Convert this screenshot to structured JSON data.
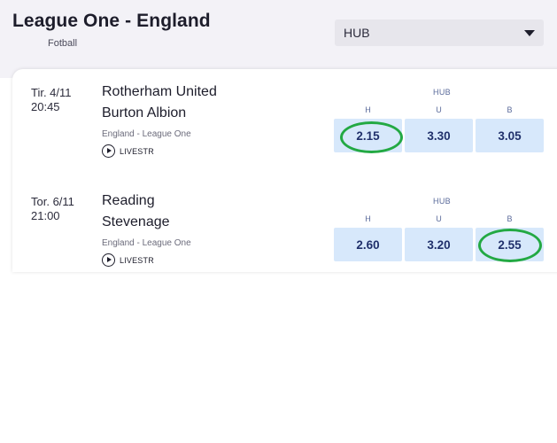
{
  "header": {
    "title": "League One - England",
    "sport": "Fotball",
    "market_select": {
      "value": "HUB"
    }
  },
  "matches": [
    {
      "date": "Tir. 4/11",
      "time": "20:45",
      "home": "Rotherham United",
      "away": "Burton Albion",
      "competition": "England - League One",
      "live_label": "LIVESTR",
      "market": "HUB",
      "outcomes": [
        {
          "label": "H",
          "odds": "2.15",
          "highlighted": true
        },
        {
          "label": "U",
          "odds": "3.30",
          "highlighted": false
        },
        {
          "label": "B",
          "odds": "3.05",
          "highlighted": false
        }
      ]
    },
    {
      "date": "Tor. 6/11",
      "time": "21:00",
      "home": "Reading",
      "away": "Stevenage",
      "competition": "England - League One",
      "live_label": "LIVESTR",
      "market": "HUB",
      "outcomes": [
        {
          "label": "H",
          "odds": "2.60",
          "highlighted": false
        },
        {
          "label": "U",
          "odds": "3.20",
          "highlighted": false
        },
        {
          "label": "B",
          "odds": "2.55",
          "highlighted": true
        }
      ]
    }
  ],
  "colors": {
    "header_bg": "#f3f2f7",
    "odds_button_bg": "#d7e8fb",
    "odds_text": "#20306b",
    "highlight_ring": "#23a943"
  },
  "icons": {
    "dropdown": "caret-down-icon",
    "livestream": "play-circle-icon"
  }
}
